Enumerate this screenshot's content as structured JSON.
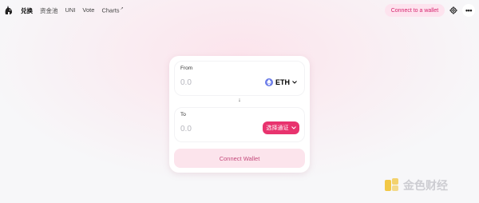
{
  "nav": {
    "links": [
      {
        "label": "兑换",
        "active": true
      },
      {
        "label": "资金池",
        "active": false
      },
      {
        "label": "UNI",
        "active": false
      },
      {
        "label": "Vote",
        "active": false
      },
      {
        "label": "Charts",
        "active": false,
        "suffix": "↗"
      }
    ],
    "connect_label": "Connect to a wallet",
    "more_label": "•••"
  },
  "swap": {
    "from": {
      "label": "From",
      "amount_placeholder": "0.0",
      "token": "ETH"
    },
    "arrow": "↓",
    "to": {
      "label": "To",
      "amount_placeholder": "0.0",
      "select_label": "选择通证"
    },
    "connect_wallet_label": "Connect Wallet"
  },
  "watermark": {
    "text": "金色财经"
  },
  "colors": {
    "accent": "#e8336e",
    "accent_soft": "#fde3ee",
    "accent_text": "#d6246e",
    "eth": "#6a7be8"
  }
}
